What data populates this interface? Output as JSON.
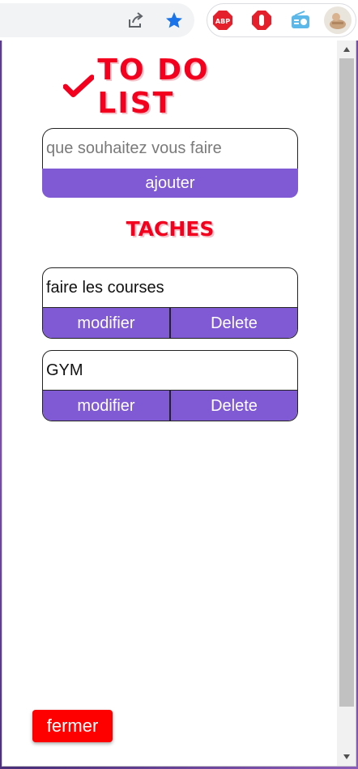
{
  "toolbar": {
    "icons": [
      "share-icon",
      "star-icon",
      "adblock-plus-icon",
      "stop-hand-icon",
      "radio-icon",
      "profile-avatar"
    ],
    "abp_text": "ABP",
    "colors": {
      "star": "#1a73e8",
      "abp": "#e4202c",
      "stop": "#e4202c",
      "radio": "#5bb8e8"
    }
  },
  "app": {
    "title": "TO DO LIST",
    "input": {
      "placeholder": "que souhaitez vous faire",
      "value": ""
    },
    "add_label": "ajouter",
    "section_title": "TACHES",
    "tasks": [
      {
        "text": "faire les courses",
        "edit_label": "modifier",
        "delete_label": "Delete"
      },
      {
        "text": "GYM",
        "edit_label": "modifier",
        "delete_label": "Delete"
      }
    ],
    "close_label": "fermer",
    "colors": {
      "accent": "#805ad5",
      "title": "#f2001d",
      "close": "#ff0000"
    }
  }
}
